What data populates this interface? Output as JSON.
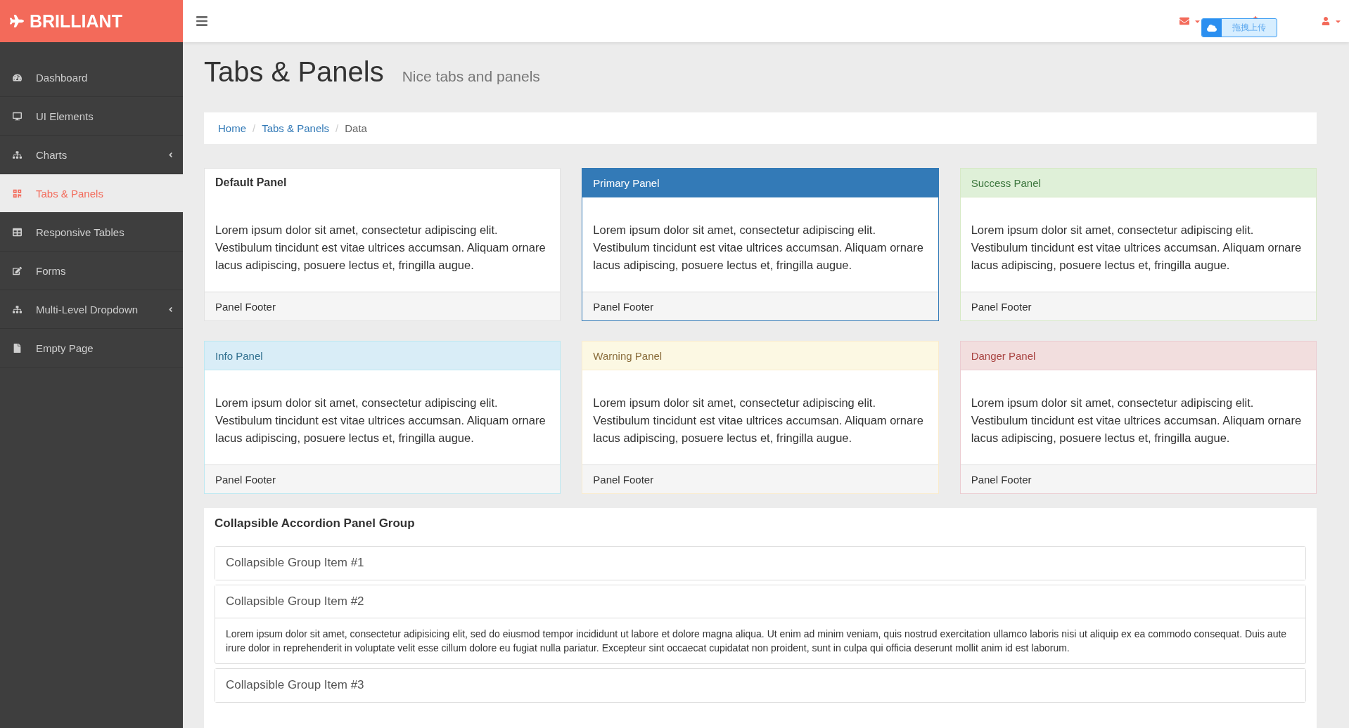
{
  "brand": "BRILLIANT",
  "sidebar": {
    "items": [
      {
        "label": "Dashboard",
        "selected": false,
        "expandable": false
      },
      {
        "label": "UI Elements",
        "selected": false,
        "expandable": false
      },
      {
        "label": "Charts",
        "selected": false,
        "expandable": true
      },
      {
        "label": "Tabs & Panels",
        "selected": true,
        "expandable": false
      },
      {
        "label": "Responsive Tables",
        "selected": false,
        "expandable": false
      },
      {
        "label": "Forms",
        "selected": false,
        "expandable": false
      },
      {
        "label": "Multi-Level Dropdown",
        "selected": false,
        "expandable": true
      },
      {
        "label": "Empty Page",
        "selected": false,
        "expandable": false
      }
    ]
  },
  "upload_widget": {
    "label": "拖拽上传"
  },
  "page_header": {
    "title": "Tabs & Panels",
    "subtitle": "Nice tabs and panels"
  },
  "breadcrumb": {
    "separator": "/",
    "items": [
      {
        "label": "Home",
        "link": true
      },
      {
        "label": "Tabs & Panels",
        "link": true
      },
      {
        "label": "Data",
        "link": false
      }
    ]
  },
  "panels": [
    {
      "kind": "default",
      "heading": "Default Panel",
      "body": "Lorem ipsum dolor sit amet, consectetur adipiscing elit. Vestibulum tincidunt est vitae ultrices accumsan. Aliquam ornare lacus adipiscing, posuere lectus et, fringilla augue.",
      "footer": "Panel Footer"
    },
    {
      "kind": "primary",
      "heading": "Primary Panel",
      "body": "Lorem ipsum dolor sit amet, consectetur adipiscing elit. Vestibulum tincidunt est vitae ultrices accumsan. Aliquam ornare lacus adipiscing, posuere lectus et, fringilla augue.",
      "footer": "Panel Footer"
    },
    {
      "kind": "success",
      "heading": "Success Panel",
      "body": "Lorem ipsum dolor sit amet, consectetur adipiscing elit. Vestibulum tincidunt est vitae ultrices accumsan. Aliquam ornare lacus adipiscing, posuere lectus et, fringilla augue.",
      "footer": "Panel Footer"
    },
    {
      "kind": "info",
      "heading": "Info Panel",
      "body": "Lorem ipsum dolor sit amet, consectetur adipiscing elit. Vestibulum tincidunt est vitae ultrices accumsan. Aliquam ornare lacus adipiscing, posuere lectus et, fringilla augue.",
      "footer": "Panel Footer"
    },
    {
      "kind": "warning",
      "heading": "Warning Panel",
      "body": "Lorem ipsum dolor sit amet, consectetur adipiscing elit. Vestibulum tincidunt est vitae ultrices accumsan. Aliquam ornare lacus adipiscing, posuere lectus et, fringilla augue.",
      "footer": "Panel Footer"
    },
    {
      "kind": "danger",
      "heading": "Danger Panel",
      "body": "Lorem ipsum dolor sit amet, consectetur adipiscing elit. Vestibulum tincidunt est vitae ultrices accumsan. Aliquam ornare lacus adipiscing, posuere lectus et, fringilla augue.",
      "footer": "Panel Footer"
    }
  ],
  "accordion": {
    "title": "Collapsible Accordion Panel Group",
    "items": [
      {
        "title": "Collapsible Group Item #1",
        "expanded": false
      },
      {
        "title": "Collapsible Group Item #2",
        "expanded": true,
        "body": "Lorem ipsum dolor sit amet, consectetur adipisicing elit, sed do eiusmod tempor incididunt ut labore et dolore magna aliqua. Ut enim ad minim veniam, quis nostrud exercitation ullamco laboris nisi ut aliquip ex ea commodo consequat. Duis aute irure dolor in reprehenderit in voluptate velit esse cillum dolore eu fugiat nulla pariatur. Excepteur sint occaecat cupidatat non proident, sunt in culpa qui officia deserunt mollit anim id est laborum."
      },
      {
        "title": "Collapsible Group Item #3",
        "expanded": false
      }
    ]
  }
}
